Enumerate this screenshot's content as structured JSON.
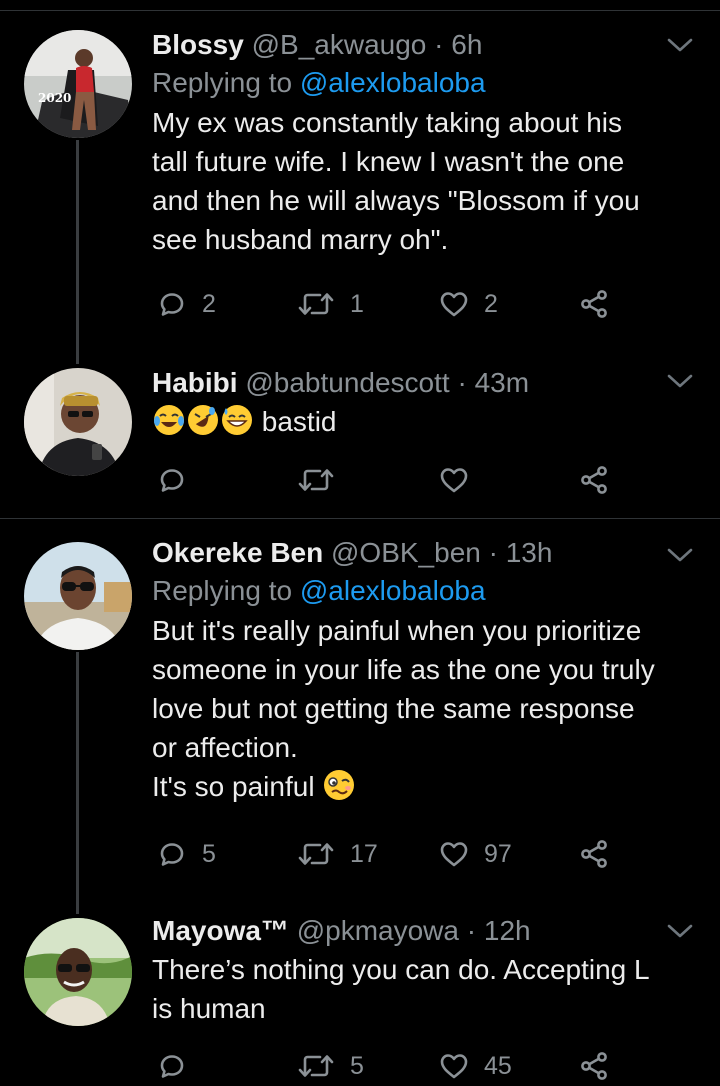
{
  "tweets": [
    {
      "name": "Blossy",
      "handle": "@B_akwaugo",
      "time": "6h",
      "reply_prefix": "Replying to",
      "reply_to": "@alexlobaloba",
      "text_lines": [
        "My ex was constantly taking about his",
        "tall future wife. I knew I wasn't the one",
        "and then he will always \"Blossom if you",
        "see husband marry oh\"."
      ],
      "replies": "2",
      "retweets": "1",
      "likes": "2"
    },
    {
      "name": "Habibi",
      "handle": "@babtundescott",
      "time": "43m",
      "text": "bastid",
      "emojis": [
        "joy",
        "rofl",
        "grin-sweat"
      ],
      "replies": "",
      "retweets": "",
      "likes": ""
    },
    {
      "name": "Okereke Ben",
      "handle": "@OBK_ben",
      "time": "13h",
      "reply_prefix": "Replying to",
      "reply_to": "@alexlobaloba",
      "text_lines": [
        "But it's really painful when you prioritize",
        "someone in your life as the one you truly",
        "love but not getting the same response",
        "or affection."
      ],
      "text_last": "It's so painful",
      "emoji_last": "woozy",
      "replies": "5",
      "retweets": "17",
      "likes": "97"
    },
    {
      "name": "Mayowa™",
      "handle": "@pkmayowa",
      "time": "12h",
      "text_lines": [
        "There’s nothing you can do. Accepting L",
        "is human"
      ],
      "replies": "",
      "retweets": "5",
      "likes": "45"
    }
  ],
  "separator": "·",
  "icons": {
    "reply": "reply-icon",
    "retweet": "retweet-icon",
    "like": "heart-icon",
    "share": "share-icon",
    "more": "chevron-down-icon"
  },
  "colors": {
    "background": "#000000",
    "text": "#ececec",
    "secondary": "#8b9196",
    "mention": "#1d9bf0",
    "divider": "#2f3336"
  }
}
